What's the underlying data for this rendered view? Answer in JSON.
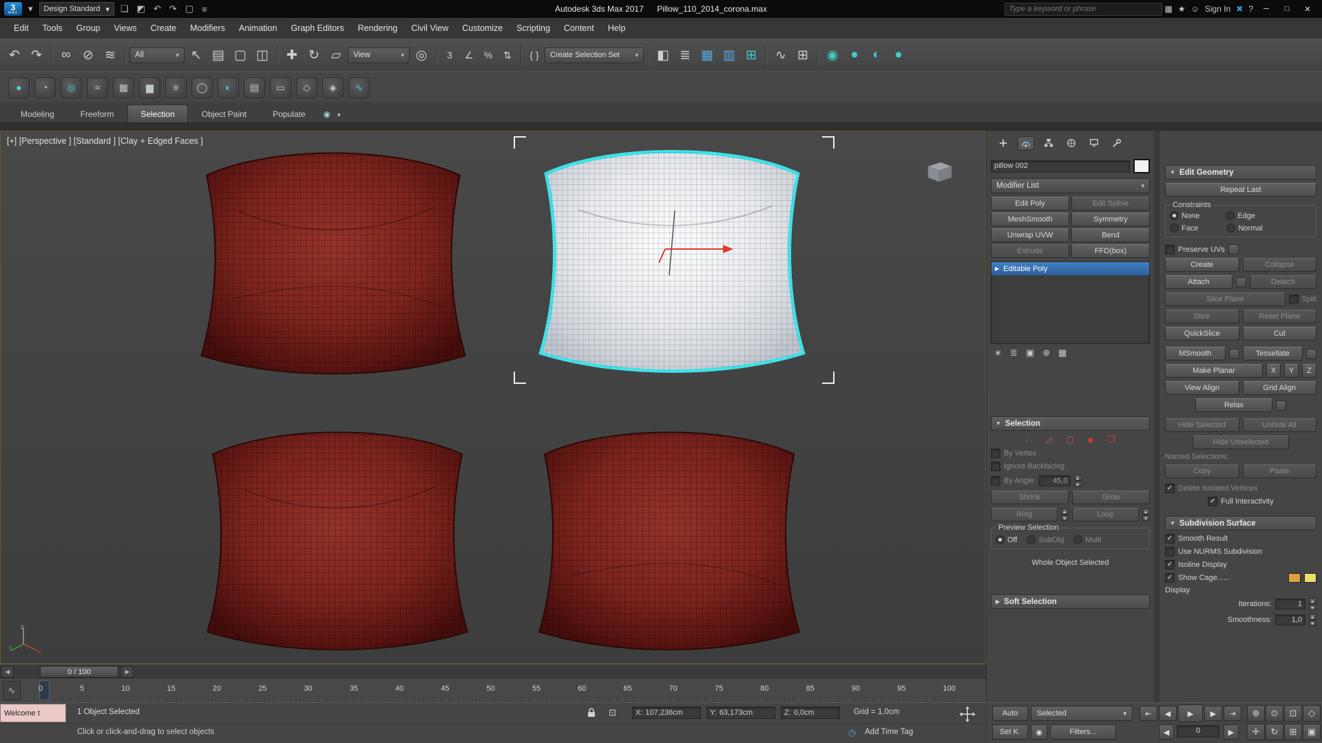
{
  "titlebar": {
    "workspace": "Design Standard",
    "app_title": "Autodesk 3ds Max 2017",
    "file_title": "Pillow_110_2014_corona.max",
    "search_placeholder": "Type a keyword or phrase",
    "sign_in": "Sign In"
  },
  "menubar": {
    "items": [
      "Edit",
      "Tools",
      "Group",
      "Views",
      "Create",
      "Modifiers",
      "Animation",
      "Graph Editors",
      "Rendering",
      "Civil View",
      "Customize",
      "Scripting",
      "Content",
      "Help"
    ]
  },
  "toolbar": {
    "selection_filter": "All",
    "ref_coord": "View",
    "named_sel": "Create Selection Set"
  },
  "ribbon": {
    "tabs": [
      "Modeling",
      "Freeform",
      "Selection",
      "Object Paint",
      "Populate"
    ]
  },
  "viewport": {
    "label": "[+] [Perspective ] [Standard ] [Clay + Edged Faces ]"
  },
  "panel": {
    "object_name": "pillow 002",
    "modifier_list": "Modifier List",
    "mod_buttons": [
      "Edit Poly",
      "Edit Spline",
      "MeshSmooth",
      "Symmetry",
      "Unwrap UVW",
      "Bend",
      "Extrude",
      "FFD(box)"
    ],
    "stack_item": "Editable Poly",
    "sel": {
      "title": "Selection",
      "by_vertex": "By Vertex",
      "ignore_backfacing": "Ignore Backfacing",
      "by_angle": "By Angle:",
      "by_angle_val": "45,0",
      "shrink": "Shrink",
      "grow": "Grow",
      "ring": "Ring",
      "loop": "Loop",
      "preview": "Preview Selection",
      "off": "Off",
      "subobj": "SubObj",
      "multi": "Multi",
      "whole": "Whole Object Selected"
    },
    "soft_selection": "Soft Selection"
  },
  "eg": {
    "title": "Edit Geometry",
    "repeat_last": "Repeat Last",
    "constraints": "Constraints",
    "none": "None",
    "edge": "Edge",
    "face": "Face",
    "normal": "Normal",
    "preserve_uvs": "Preserve UVs",
    "create": "Create",
    "collapse": "Collapse",
    "attach": "Attach",
    "detach": "Detach",
    "slice_plane": "Slice Plane",
    "split": "Split",
    "slice": "Slice",
    "reset_plane": "Reset Plane",
    "quickslice": "QuickSlice",
    "cut": "Cut",
    "msmooth": "MSmooth",
    "tessellate": "Tessellate",
    "make_planar": "Make Planar",
    "x": "X",
    "y": "Y",
    "z": "Z",
    "view_align": "View Align",
    "grid_align": "Grid Align",
    "relax": "Relax",
    "hide_selected": "Hide Selected",
    "unhide_all": "Unhide All",
    "hide_unselected": "Hide Unselected",
    "named_selections": "Named Selections:",
    "copy": "Copy",
    "paste": "Paste",
    "delete_isolated": "Delete Isolated Vertices",
    "full_interactivity": "Full Interactivity"
  },
  "subdiv": {
    "title": "Subdivision Surface",
    "smooth_result": "Smooth Result",
    "use_nurms": "Use NURMS Subdivision",
    "isoline": "Isoline Display",
    "show_cage": "Show Cage......",
    "display": "Display",
    "iterations": "Iterations:",
    "iterations_val": "1",
    "smoothness": "Smoothness:",
    "smoothness_val": "1,0"
  },
  "timeline": {
    "slider": "0 / 100",
    "ticks": [
      "0",
      "5",
      "10",
      "15",
      "20",
      "25",
      "30",
      "35",
      "40",
      "45",
      "50",
      "55",
      "60",
      "65",
      "70",
      "75",
      "80",
      "85",
      "90",
      "95",
      "100"
    ]
  },
  "status": {
    "listener": "Welcome t",
    "selected": "1 Object Selected",
    "prompt": "Click or click-and-drag to select objects",
    "x_label": "X:",
    "x": "107,236cm",
    "y_label": "Y:",
    "y": "63,173cm",
    "z_label": "Z:",
    "z": "0,0cm",
    "grid": "Grid = 1,0cm",
    "add_time_tag": "Add Time Tag"
  },
  "anim": {
    "auto": "Auto",
    "selected": "Selected",
    "set_key": "Set K.",
    "filters": "Filters...",
    "frame": "0"
  },
  "icons": {
    "logo": "3",
    "logo_sub": "MAX",
    "dd": "▾",
    "arr_open": "▼",
    "arr_closed": "▶",
    "check": "✓",
    "open_doc": "❏",
    "save_doc": "◩",
    "new_doc": "▢",
    "hamb": "≡",
    "undo": "↶",
    "redo": "↷",
    "link": "∞",
    "unlink": "⊘",
    "bind": "≋",
    "cursor": "↖",
    "by_name": "▤",
    "region": "▢",
    "windowx": "◫",
    "move": "✚",
    "rotate": "↻",
    "scale": "▱",
    "manip": "◎",
    "snap": "3",
    "snap_angle": "∠",
    "snap_pct": "%",
    "snap_spin": "⇅",
    "braces": "{ }",
    "mirror": "◧",
    "align": "≣",
    "layers": "▦",
    "explorer": "▥",
    "curve": "∿",
    "schem": "⊞",
    "mat": "◉",
    "rset": "●",
    "rframe": "◐",
    "rprod": "●",
    "apps": "▦",
    "star": "★",
    "user": "☺",
    "x360": "✖",
    "help": "?",
    "min": "─",
    "max": "□",
    "close": "✕",
    "t0": "●",
    "t1": "◔",
    "t2": "◎",
    "t3": "≈",
    "t4": "▦",
    "t5": "▆",
    "t6": "≡",
    "t7": "◯",
    "t8": "◐",
    "t9": "▤",
    "t10": "▭",
    "t11": "◇",
    "t12": "◈",
    "t13": "∿",
    "sub_v": "∴",
    "sub_e": "◿",
    "sub_b": "▢",
    "sub_p": "■",
    "sub_el": "❒",
    "st0": "∗",
    "st1": "≣",
    "st2": "▣",
    "st3": "⊗",
    "st4": "▦",
    "go_start": "⇤",
    "prev": "◀",
    "play": "▶",
    "next": "▶",
    "go_end": "⇥",
    "n0": "⊕",
    "n1": "⊙",
    "n2": "⊡",
    "n3": "◇",
    "n4": "✛",
    "n5": "↻",
    "n6": "⊞",
    "n7": "▣",
    "clock": "◷",
    "keyfil": "◉",
    "mini_curve": "∿",
    "ribbon_cfg": "◉"
  }
}
